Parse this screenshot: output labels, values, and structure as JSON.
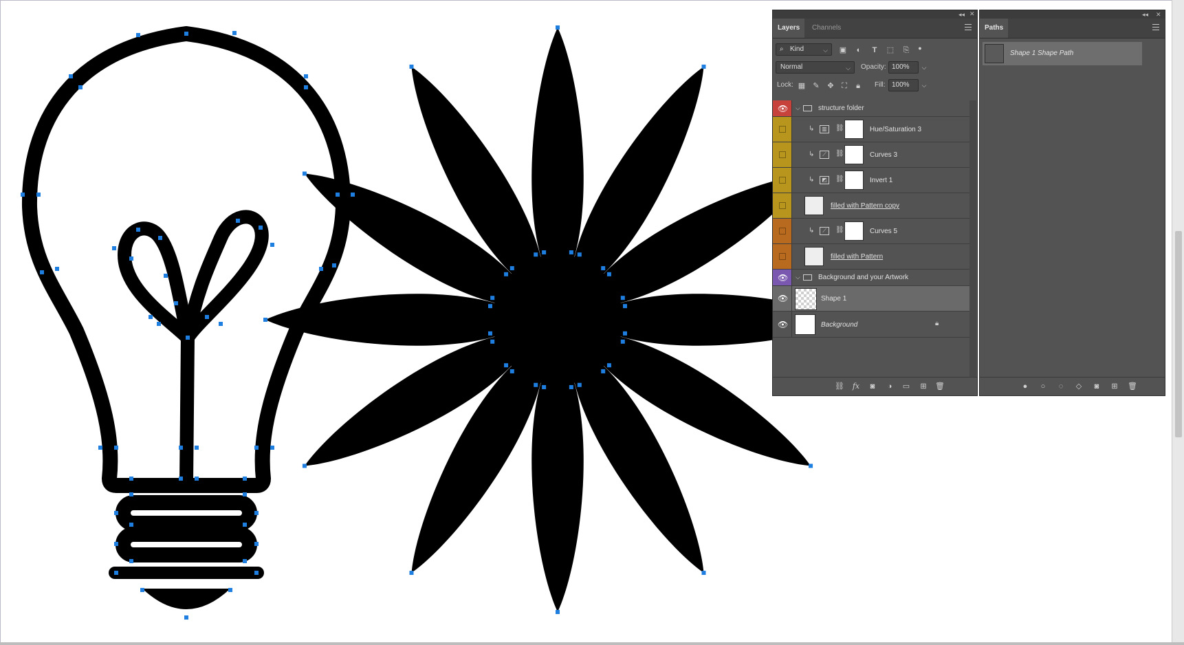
{
  "layers_panel": {
    "tabs": [
      "Layers",
      "Channels"
    ],
    "filter": {
      "kind_label": "Kind"
    },
    "blend_mode": "Normal",
    "opacity_label": "Opacity:",
    "opacity_value": "100%",
    "lock_label": "Lock:",
    "fill_label": "Fill:",
    "fill_value": "100%",
    "layers": [
      {
        "name": "structure folder",
        "type": "group",
        "color": "#c8423c",
        "visible": true
      },
      {
        "name": "Hue/Saturation 3",
        "type": "adjustment",
        "color": "#b8961e",
        "visible": false
      },
      {
        "name": "Curves 3",
        "type": "adjustment",
        "color": "#b8961e",
        "visible": false
      },
      {
        "name": "Invert 1",
        "type": "adjustment",
        "color": "#b8961e",
        "visible": false
      },
      {
        "name": "filled with Pattern copy",
        "type": "fill",
        "color": "#b8961e",
        "visible": false
      },
      {
        "name": "Curves 5",
        "type": "adjustment",
        "color": "#b86a1e",
        "visible": false
      },
      {
        "name": "filled with Pattern",
        "type": "fill",
        "color": "#b86a1e",
        "visible": false
      },
      {
        "name": "Background and your Artwork",
        "type": "group",
        "color": "#7a58b0",
        "visible": true
      },
      {
        "name": "Shape 1",
        "type": "shape",
        "color": "",
        "visible": true,
        "selected": true
      },
      {
        "name": "Background",
        "type": "background",
        "color": "",
        "visible": true,
        "locked": true
      }
    ]
  },
  "paths_panel": {
    "tab": "Paths",
    "paths": [
      {
        "name": "Shape 1 Shape Path",
        "selected": true
      }
    ]
  }
}
